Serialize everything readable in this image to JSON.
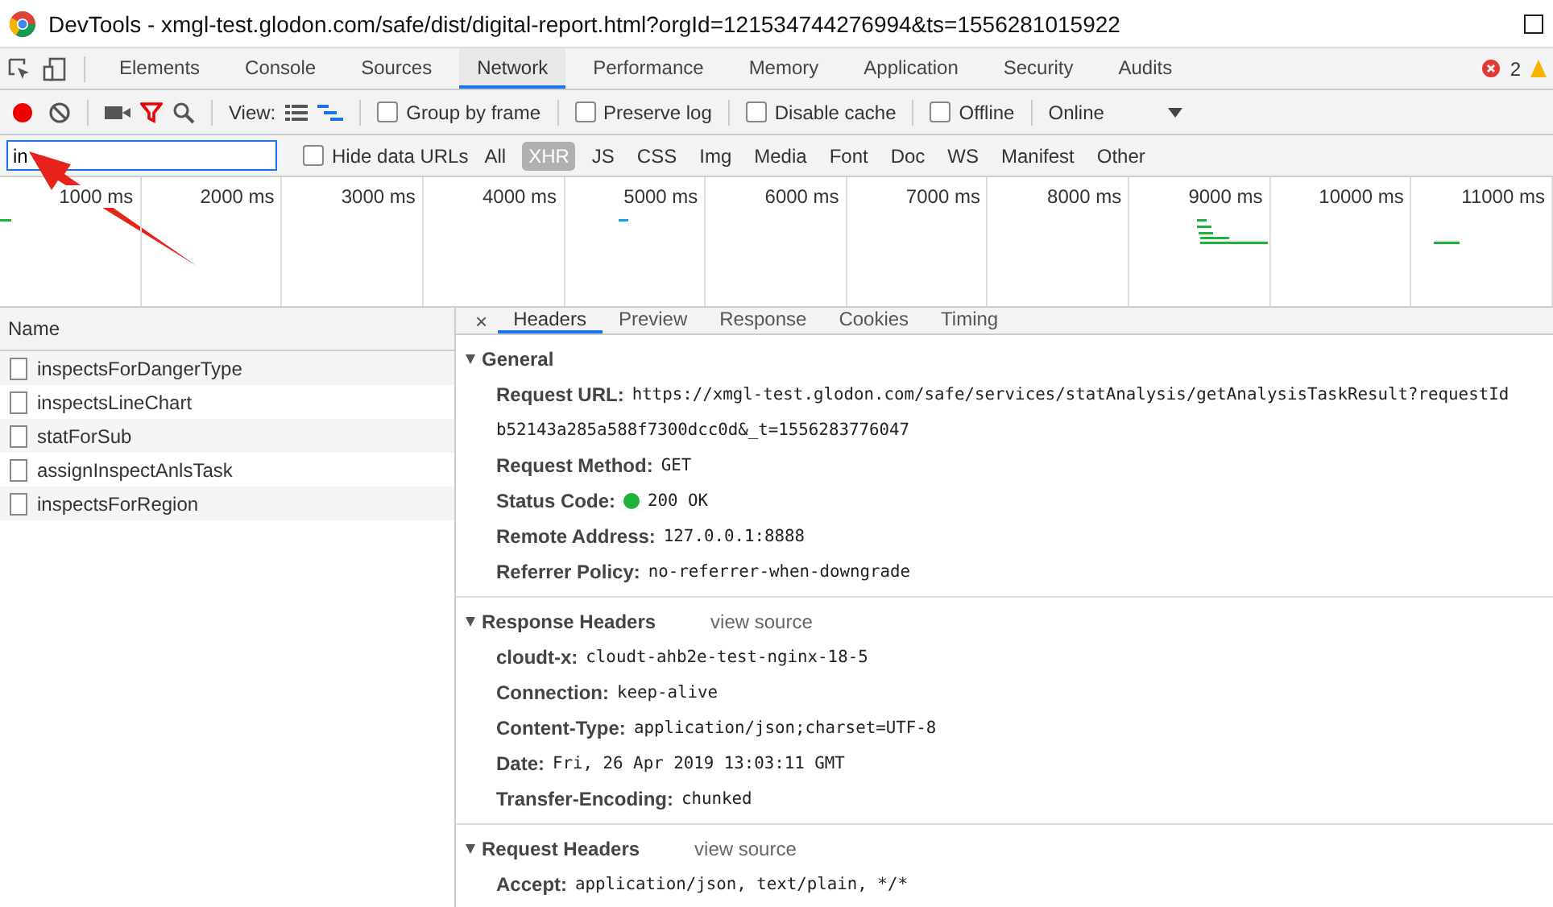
{
  "window": {
    "title": "DevTools - xmgl-test.glodon.com/safe/dist/digital-report.html?orgId=121534744276994&ts=1556281015922"
  },
  "panel_tabs": [
    {
      "label": "Elements",
      "selected": false
    },
    {
      "label": "Console",
      "selected": false
    },
    {
      "label": "Sources",
      "selected": false
    },
    {
      "label": "Network",
      "selected": true
    },
    {
      "label": "Performance",
      "selected": false
    },
    {
      "label": "Memory",
      "selected": false
    },
    {
      "label": "Application",
      "selected": false
    },
    {
      "label": "Security",
      "selected": false
    },
    {
      "label": "Audits",
      "selected": false
    }
  ],
  "error_count": "2",
  "toolbar": {
    "recording": true,
    "filter_on": true,
    "view_label": "View:",
    "waterfall_view": true,
    "checkboxes": [
      {
        "label": "Group by frame",
        "checked": false
      },
      {
        "label": "Preserve log",
        "checked": false
      },
      {
        "label": "Disable cache",
        "checked": false
      },
      {
        "label": "Offline",
        "checked": false
      }
    ],
    "throttling": "Online"
  },
  "filter": {
    "value": "in",
    "hide_data_urls": {
      "label": "Hide data URLs",
      "checked": false
    },
    "types": [
      {
        "label": "All",
        "selected": false
      },
      {
        "label": "XHR",
        "selected": true
      },
      {
        "label": "JS",
        "selected": false
      },
      {
        "label": "CSS",
        "selected": false
      },
      {
        "label": "Img",
        "selected": false
      },
      {
        "label": "Media",
        "selected": false
      },
      {
        "label": "Font",
        "selected": false
      },
      {
        "label": "Doc",
        "selected": false
      },
      {
        "label": "WS",
        "selected": false
      },
      {
        "label": "Manifest",
        "selected": false
      },
      {
        "label": "Other",
        "selected": false
      }
    ]
  },
  "timeline": {
    "ticks": [
      "1000 ms",
      "2000 ms",
      "3000 ms",
      "4000 ms",
      "5000 ms",
      "6000 ms",
      "7000 ms",
      "8000 ms",
      "9000 ms",
      "10000 ms",
      "11000 ms"
    ]
  },
  "requests": {
    "column": "Name",
    "rows": [
      "inspectsForDangerType",
      "inspectsLineChart",
      "statForSub",
      "assignInspectAnlsTask",
      "inspectsForRegion"
    ]
  },
  "detail_close": "×",
  "detail_tabs": [
    {
      "label": "Headers",
      "selected": true
    },
    {
      "label": "Preview",
      "selected": false
    },
    {
      "label": "Response",
      "selected": false
    },
    {
      "label": "Cookies",
      "selected": false
    },
    {
      "label": "Timing",
      "selected": false
    }
  ],
  "sections": [
    {
      "title": "General",
      "expanded": true,
      "rows": [
        {
          "key": "Request URL:",
          "value_lines": [
            "https://xmgl-test.glodon.com/safe/services/statAnalysis/getAnalysisTaskResult?requestId",
            "b52143a285a588f7300dcc0d&_t=1556283776047"
          ]
        },
        {
          "key": "Request Method:",
          "value_lines": [
            "GET"
          ]
        },
        {
          "key": "Status Code:",
          "value_lines": [
            "200 OK"
          ],
          "color": "#1db33a"
        },
        {
          "key": "Remote Address:",
          "value_lines": [
            "127.0.0.1:8888"
          ]
        },
        {
          "key": "Referrer Policy:",
          "value_lines": [
            "no-referrer-when-downgrade"
          ]
        }
      ]
    },
    {
      "title": "Response Headers",
      "expanded": true,
      "link": "view source",
      "rows": [
        {
          "key": "cloudt-x:",
          "value_lines": [
            "cloudt-ahb2e-test-nginx-18-5"
          ]
        },
        {
          "key": "Connection:",
          "value_lines": [
            "keep-alive"
          ]
        },
        {
          "key": "Content-Type:",
          "value_lines": [
            "application/json;charset=UTF-8"
          ]
        },
        {
          "key": "Date:",
          "value_lines": [
            "Fri, 26 Apr 2019 13:03:11 GMT"
          ]
        },
        {
          "key": "Transfer-Encoding:",
          "value_lines": [
            "chunked"
          ]
        }
      ]
    },
    {
      "title": "Request Headers",
      "expanded": true,
      "link": "view source",
      "rows": [
        {
          "key": "Accept:",
          "value_lines": [
            "application/json, text/plain, */*"
          ]
        }
      ]
    }
  ]
}
